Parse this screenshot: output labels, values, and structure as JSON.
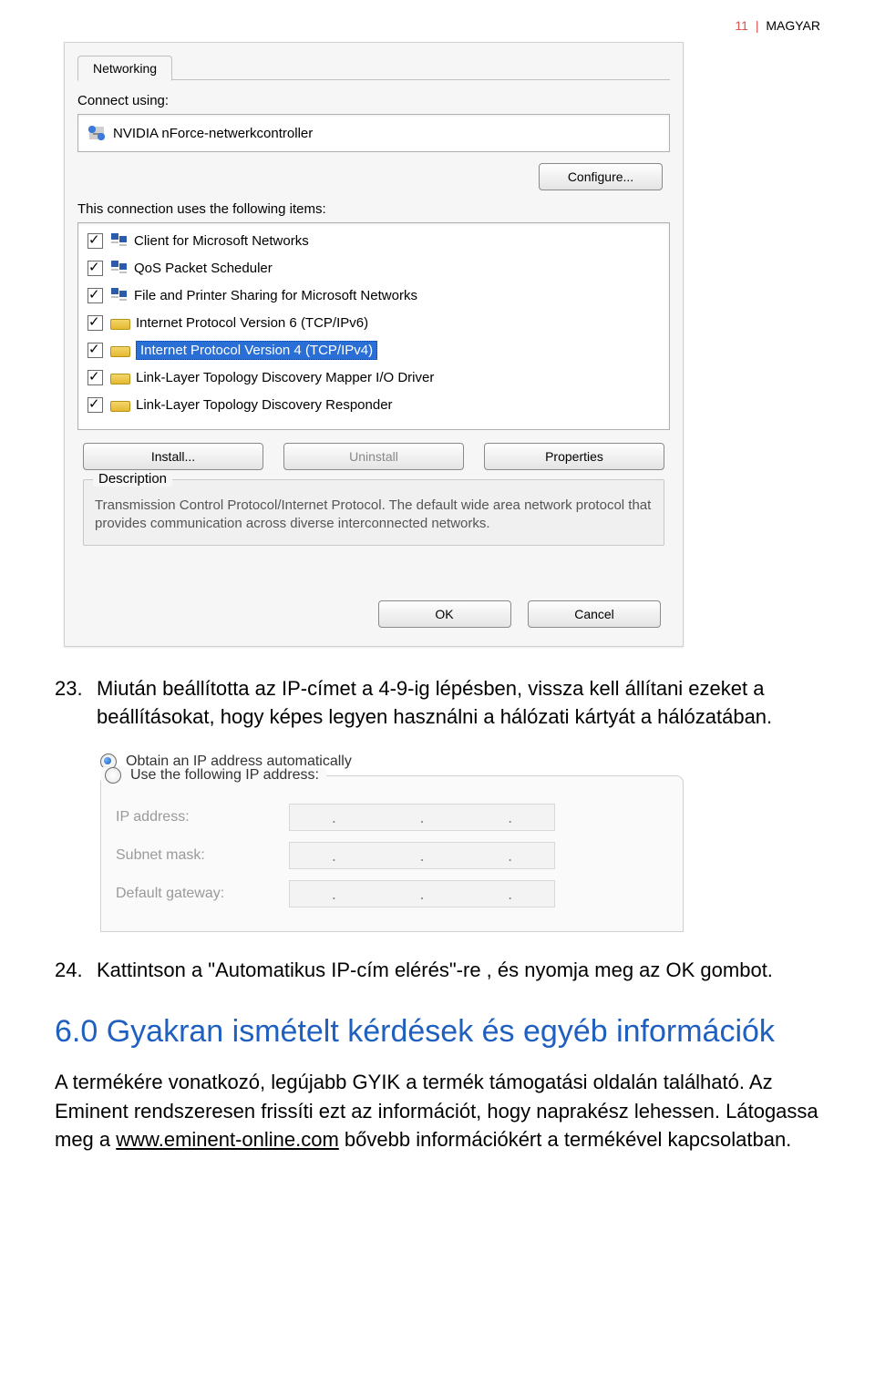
{
  "header": {
    "page_number": "11",
    "lang": "MAGYAR"
  },
  "dialog": {
    "tab_label": "Networking",
    "connect_using_label": "Connect using:",
    "adapter_name": "NVIDIA nForce-netwerkcontroller",
    "configure_btn": "Configure...",
    "uses_label": "This connection uses the following items:",
    "items": [
      {
        "label": "Client for Microsoft Networks",
        "checked": true,
        "icon": "screens",
        "selected": false
      },
      {
        "label": "QoS Packet Scheduler",
        "checked": true,
        "icon": "screens",
        "selected": false
      },
      {
        "label": "File and Printer Sharing for Microsoft Networks",
        "checked": true,
        "icon": "screens",
        "selected": false
      },
      {
        "label": "Internet Protocol Version 6 (TCP/IPv6)",
        "checked": true,
        "icon": "proto",
        "selected": false
      },
      {
        "label": "Internet Protocol Version 4 (TCP/IPv4)",
        "checked": true,
        "icon": "proto",
        "selected": true
      },
      {
        "label": "Link-Layer Topology Discovery Mapper I/O Driver",
        "checked": true,
        "icon": "proto",
        "selected": false
      },
      {
        "label": "Link-Layer Topology Discovery Responder",
        "checked": true,
        "icon": "proto",
        "selected": false
      }
    ],
    "install_btn": "Install...",
    "uninstall_btn": "Uninstall",
    "properties_btn": "Properties",
    "description_label": "Description",
    "description_text": "Transmission Control Protocol/Internet Protocol. The default wide area network protocol that provides communication across diverse interconnected networks.",
    "ok_btn": "OK",
    "cancel_btn": "Cancel"
  },
  "doc": {
    "item23_num": "23.",
    "item23_text": "Miután beállította az IP-címet a 4-9-ig lépésben, vissza kell állítani ezeket a beállításokat, hogy képes legyen használni a hálózati kártyát a hálózatában.",
    "item24_num": "24.",
    "item24_text": "Kattintson a \"Automatikus IP-cím elérés\"-re , és nyomja meg az OK gombot.",
    "section_heading": "6.0 Gyakran ismételt kérdések és egyéb információk",
    "body_text_pre": "A termékére vonatkozó, legújabb GYIK a termék támogatási oldalán található. Az Eminent rendszeresen frissíti ezt az információt, hogy naprakész lehessen. Látogassa meg a ",
    "body_link": "www.eminent-online.com",
    "body_text_post": " bővebb információkért a termékével kapcsolatban."
  },
  "ip_pane": {
    "radio_auto": "Obtain an IP address automatically",
    "radio_manual": "Use the following IP address:",
    "ip_addr_label": "IP address:",
    "subnet_label": "Subnet mask:",
    "gateway_label": "Default gateway:"
  }
}
